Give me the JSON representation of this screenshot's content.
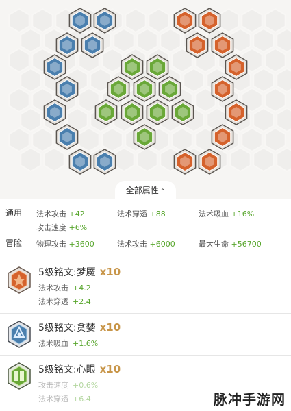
{
  "header": {
    "all_attributes_label": "全部属性",
    "caret": "^"
  },
  "board": {
    "rune_colors": {
      "blue": "#4a7fae",
      "green": "#6aa838",
      "red": "#d5622c"
    },
    "icons": [
      "blue-rune-icon",
      "green-rune-icon",
      "red-rune-icon"
    ]
  },
  "attributes": {
    "general": {
      "label": "通用",
      "items": [
        {
          "name": "法术攻击",
          "value": "+42"
        },
        {
          "name": "法术穿透",
          "value": "+88"
        },
        {
          "name": "法术吸血",
          "value": "+16%"
        },
        {
          "name": "攻击速度",
          "value": "+6%"
        }
      ]
    },
    "adventure": {
      "label": "冒险",
      "items": [
        {
          "name": "物理攻击",
          "value": "+3600"
        },
        {
          "name": "法术攻击",
          "value": "+6000"
        },
        {
          "name": "最大生命",
          "value": "+56700"
        }
      ]
    }
  },
  "runes": [
    {
      "title": "5级铭文:梦魇",
      "count": "x10",
      "color": "red",
      "stats": [
        {
          "name": "法术攻击",
          "value": "+4.2"
        },
        {
          "name": "法术穿透",
          "value": "+2.4"
        }
      ]
    },
    {
      "title": "5级铭文:贪婪",
      "count": "x10",
      "color": "blue",
      "stats": [
        {
          "name": "法术吸血",
          "value": "+1.6%"
        }
      ]
    },
    {
      "title": "5级铭文:心眼",
      "count": "x10",
      "color": "green",
      "stats": [
        {
          "name": "攻击速度",
          "value": "+0.6%"
        },
        {
          "name": "法术穿透",
          "value": "+6.4"
        }
      ]
    }
  ],
  "watermark": "脉冲手游网"
}
